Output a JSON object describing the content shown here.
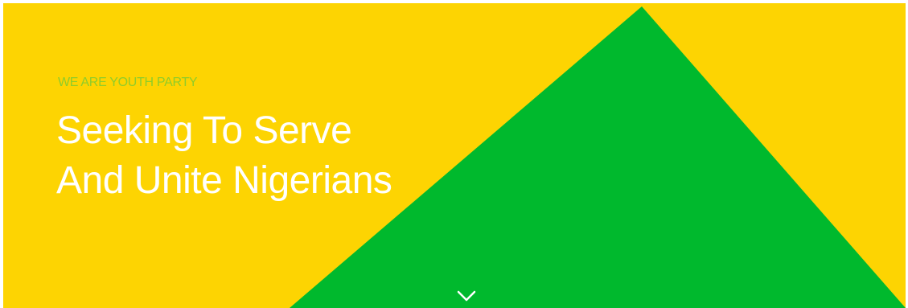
{
  "hero": {
    "eyebrow": "WE ARE YOUTH PARTY",
    "headline_line1": "Seeking To Serve",
    "headline_line2": "And Unite Nigerians",
    "scroll_icon": "chevron-down-icon"
  },
  "colors": {
    "background_yellow": "#fdd402",
    "triangle_green": "#00b92d",
    "eyebrow_green": "#8fcc2a",
    "headline_white": "#ffffff"
  }
}
